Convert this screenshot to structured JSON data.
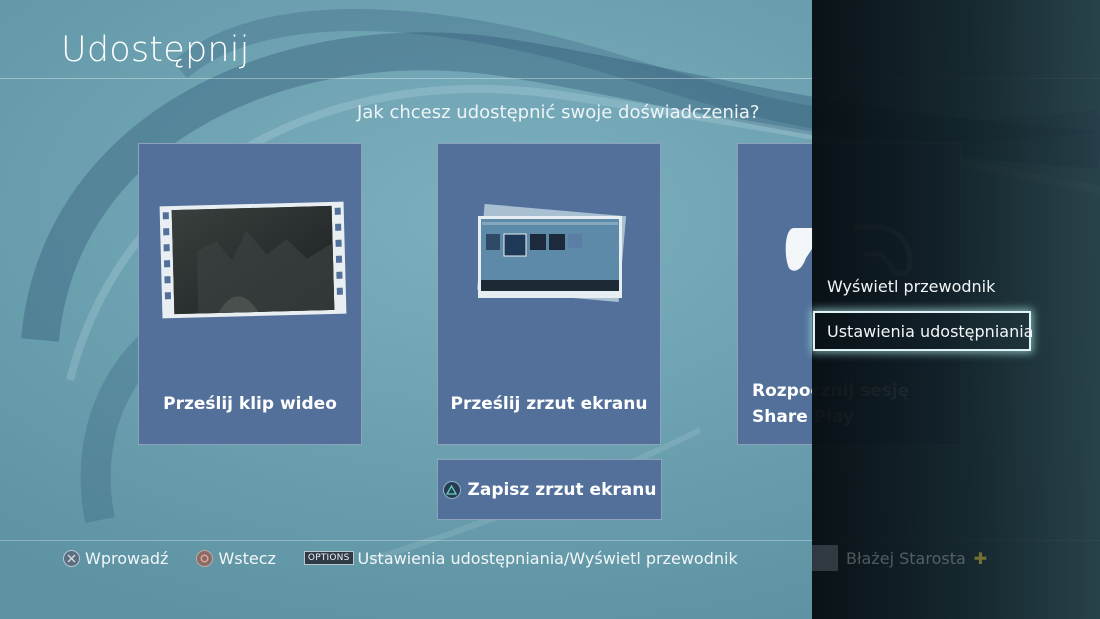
{
  "header": {
    "title": "Udostępnij"
  },
  "question": "Jak chcesz udostępnić swoje doświadczenia?",
  "cards": [
    {
      "label": "Prześlij klip wideo",
      "icon": "film-strip-icon"
    },
    {
      "label": "Prześlij zrzut ekranu",
      "icon": "screenshot-thumbnail-icon"
    },
    {
      "label": "Rozpocznij sesję Share Play",
      "icon": "controller-icon"
    }
  ],
  "save_button": {
    "label": "Zapisz zrzut ekranu",
    "icon": "triangle-button-icon"
  },
  "hints": [
    {
      "icon": "cross-button-icon",
      "label": "Wprowadź"
    },
    {
      "icon": "circle-button-icon",
      "label": "Wstecz"
    },
    {
      "icon": "options-button-icon",
      "badge": "OPTIONS",
      "label": "Ustawienia udostępniania/Wyświetl przewodnik"
    }
  ],
  "options_menu": {
    "items": [
      {
        "label": "Wyświetl przewodnik"
      },
      {
        "label": "Ustawienia udostępniania",
        "selected": true
      }
    ]
  },
  "user": {
    "name": "Błażej Starosta"
  },
  "colors": {
    "background": "#6a9fae",
    "card": "#52709a",
    "panel": "#0a161b",
    "focus_glow": "#dff3f4"
  }
}
